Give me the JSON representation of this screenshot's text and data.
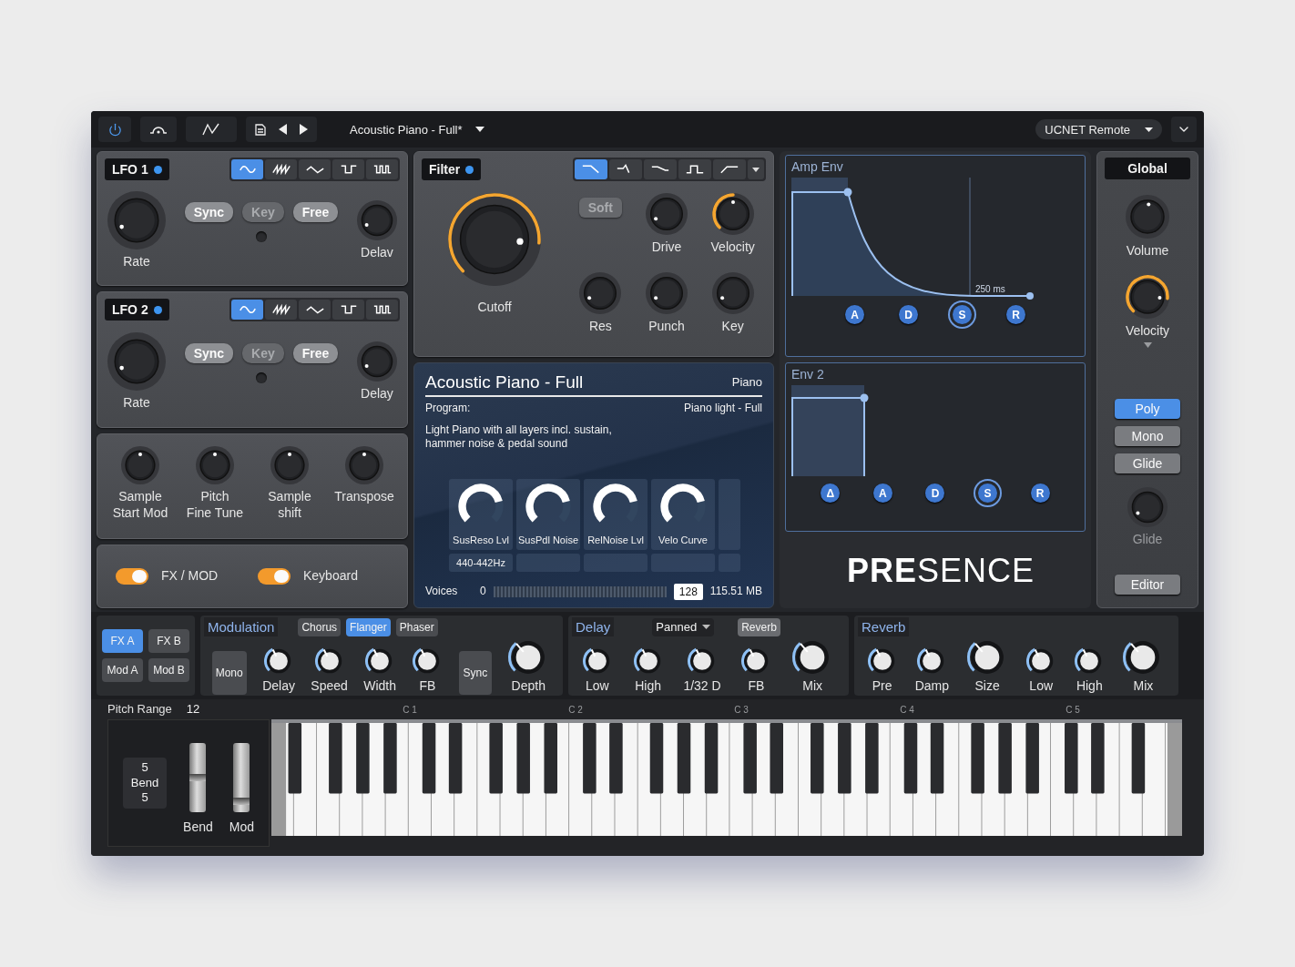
{
  "top_bar": {
    "preset": "Acoustic Piano - Full*",
    "remote": "UCNET Remote"
  },
  "lfos": [
    {
      "title": "LFO 1",
      "active": true,
      "waves": [
        {
          "kind": "sine",
          "selected": true
        },
        {
          "kind": "saw",
          "selected": false
        },
        {
          "kind": "triangle",
          "selected": false
        },
        {
          "kind": "square",
          "selected": false
        },
        {
          "kind": "pulse",
          "selected": false
        }
      ],
      "modes": [
        {
          "label": "Sync",
          "selected": true
        },
        {
          "label": "Key",
          "selected": false
        },
        {
          "label": "Free",
          "selected": true
        }
      ],
      "rate": {
        "label": "Rate"
      },
      "delay": {
        "label": "Delav"
      }
    },
    {
      "title": "LFO 2",
      "active": true,
      "waves": [
        {
          "kind": "sine",
          "selected": true
        },
        {
          "kind": "saw",
          "selected": false
        },
        {
          "kind": "triangle",
          "selected": false
        },
        {
          "kind": "square",
          "selected": false
        },
        {
          "kind": "pulse",
          "selected": false
        }
      ],
      "modes": [
        {
          "label": "Sync",
          "selected": true
        },
        {
          "label": "Key",
          "selected": false
        },
        {
          "label": "Free",
          "selected": true
        }
      ],
      "rate": {
        "label": "Rate"
      },
      "delay": {
        "label": "Delay"
      }
    }
  ],
  "sample_knobs": [
    {
      "label": "Sample\nStart Mod"
    },
    {
      "label": "Pitch\nFine Tune"
    },
    {
      "label": "Sample\nshift"
    },
    {
      "label": "Transpose"
    }
  ],
  "toggles": [
    {
      "label": "FX / MOD",
      "on": true
    },
    {
      "label": "Keyboard",
      "on": true
    }
  ],
  "filter": {
    "title": "Filter",
    "active": true,
    "types": [
      {
        "kind": "lowpass",
        "selected": true
      },
      {
        "kind": "peak",
        "selected": false
      },
      {
        "kind": "slope",
        "selected": false
      },
      {
        "kind": "bandpass",
        "selected": false
      },
      {
        "kind": "highpass",
        "selected": false
      }
    ],
    "controls": [
      {
        "kind": "large_knob",
        "label": "Cutoff",
        "arc": true
      },
      {
        "kind": "button",
        "label": "Soft",
        "selected": false
      },
      {
        "kind": "knob",
        "label": "Drive",
        "arc": false
      },
      {
        "kind": "knob",
        "label": "Velocity",
        "arc": true
      },
      {
        "kind": "knob",
        "label": "Res",
        "arc": false
      },
      {
        "kind": "knob",
        "label": "Punch",
        "arc": false
      },
      {
        "kind": "knob",
        "label": "Key",
        "arc": false
      }
    ]
  },
  "info": {
    "title": "Acoustic Piano - Full",
    "category": "Piano",
    "program_label": "Program:",
    "program": "Piano light - Full",
    "description": "Light Piano with all layers incl. sustain,\nhammer noise & pedal sound",
    "macros": [
      {
        "label": "SusReso Lvl",
        "value": "440-442Hz"
      },
      {
        "label": "SusPdl Noise"
      },
      {
        "label": "RelNoise Lvl"
      },
      {
        "label": "Velo Curve"
      }
    ],
    "voices": {
      "label": "Voices",
      "min": "0",
      "max": "128",
      "memory": "115.51 MB"
    }
  },
  "envelopes": [
    {
      "title": "Amp Env",
      "kind": "decay",
      "note": "250 ms",
      "stages": [
        {
          "label": "A",
          "selected": false
        },
        {
          "label": "D",
          "selected": false
        },
        {
          "label": "S",
          "selected": true
        },
        {
          "label": "R",
          "selected": false
        }
      ]
    },
    {
      "title": "Env 2",
      "kind": "gate",
      "stages": [
        {
          "label": "Δ",
          "selected": false
        },
        {
          "label": "A",
          "selected": false
        },
        {
          "label": "D",
          "selected": false
        },
        {
          "label": "S",
          "selected": true
        },
        {
          "label": "R",
          "selected": false
        }
      ]
    }
  ],
  "logo": "**PRE**SENCE",
  "global": {
    "title": "Global",
    "knobs": [
      {
        "label": "Volume",
        "arc": false
      },
      {
        "label": "Velocity",
        "arc": true
      }
    ],
    "modes": [
      {
        "label": "Poly",
        "selected": true
      },
      {
        "label": "Mono",
        "selected": false
      },
      {
        "label": "Glide",
        "selected": false
      }
    ],
    "glide": {
      "label": "Glide",
      "disabled": true
    },
    "editor": "Editor"
  },
  "fx": {
    "slots": [
      {
        "label": "FX A",
        "selected": true
      },
      {
        "label": "FX B",
        "selected": false
      },
      {
        "label": "Mod A",
        "selected": false
      },
      {
        "label": "Mod B",
        "selected": false
      }
    ],
    "modulation": {
      "title": "Modulation",
      "types": [
        {
          "label": "Chorus",
          "selected": false
        },
        {
          "label": "Flanger",
          "selected": true
        },
        {
          "label": "Phaser",
          "selected": false
        }
      ],
      "items": [
        {
          "kind": "button",
          "label": "Mono"
        },
        {
          "kind": "knob",
          "label": "Delay"
        },
        {
          "kind": "knob",
          "label": "Speed"
        },
        {
          "kind": "knob",
          "label": "Width"
        },
        {
          "kind": "knob",
          "label": "FB"
        },
        {
          "kind": "button",
          "label": "Sync"
        },
        {
          "kind": "large_knob",
          "label": "Depth"
        }
      ]
    },
    "delay": {
      "title": "Delay",
      "mode": "Panned",
      "send": "Reverb",
      "items": [
        {
          "kind": "knob",
          "label": "Low"
        },
        {
          "kind": "knob",
          "label": "High"
        },
        {
          "kind": "knob",
          "label": "1/32 D"
        },
        {
          "kind": "knob",
          "label": "FB"
        },
        {
          "kind": "large_knob",
          "label": "Mix"
        }
      ]
    },
    "reverb": {
      "title": "Reverb",
      "items": [
        {
          "kind": "knob",
          "label": "Pre"
        },
        {
          "kind": "knob",
          "label": "Damp"
        },
        {
          "kind": "large_knob",
          "label": "Size"
        },
        {
          "kind": "knob",
          "label": "Low"
        },
        {
          "kind": "knob",
          "label": "High"
        },
        {
          "kind": "large_knob",
          "label": "Mix"
        }
      ]
    }
  },
  "keyboard": {
    "pitch_range_label": "Pitch Range",
    "pitch_range": "12",
    "octaves": [
      "C 1",
      "C 2",
      "C 3",
      "C 4",
      "C 5"
    ],
    "bend_display": [
      "5",
      "Bend",
      "5"
    ],
    "wheels": [
      {
        "label": "Bend",
        "level": 0.5
      },
      {
        "label": "Mod",
        "level": 0.12
      }
    ]
  }
}
